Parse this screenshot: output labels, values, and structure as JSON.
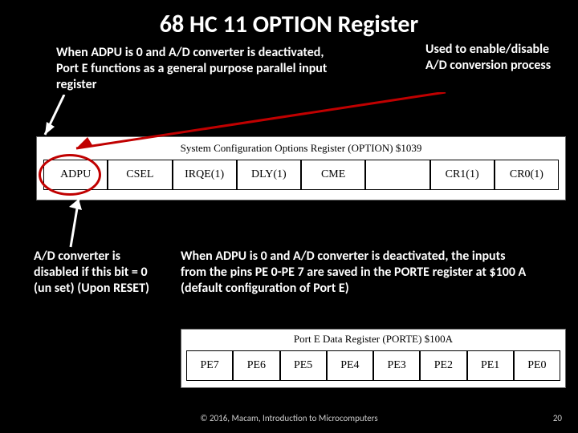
{
  "title": "68 HC 11 OPTION Register",
  "notes": {
    "note1": "When ADPU is 0 and A/D converter is deactivated, Port E functions as a general purpose parallel input register",
    "note2": "Used to enable/disable A/D conversion process",
    "note3": "A/D converter is disabled if this bit = 0 (un set) (Upon RESET)",
    "note4": "When ADPU is 0 and A/D converter is deactivated, the inputs from the pins PE 0-PE 7 are saved in the PORTE register at $100 A (default configuration of Port E)"
  },
  "option_register": {
    "caption": "System Configuration Options Register (OPTION) $1039",
    "bits": [
      "ADPU",
      "CSEL",
      "IRQE(1)",
      "DLY(1)",
      "CME",
      "",
      "CR1(1)",
      "CR0(1)"
    ]
  },
  "porte_register": {
    "caption": "Port E Data Register (PORTE) $100A",
    "bits": [
      "PE7",
      "PE6",
      "PE5",
      "PE4",
      "PE3",
      "PE2",
      "PE1",
      "PE0"
    ]
  },
  "footer": {
    "copyright": "© 2016, Macam, Introduction to Microcomputers",
    "page": "20"
  }
}
